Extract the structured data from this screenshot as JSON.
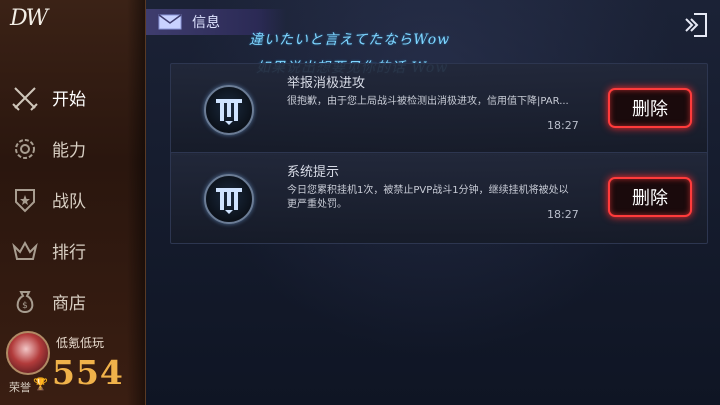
{
  "logo": "DW",
  "sidebar": {
    "items": [
      {
        "label": "开始",
        "icon": "crossed-swords-icon",
        "active": true
      },
      {
        "label": "能力",
        "icon": "gear-icon"
      },
      {
        "label": "战队",
        "icon": "shield-star-icon"
      },
      {
        "label": "排行",
        "icon": "crown-icon"
      },
      {
        "label": "商店",
        "icon": "money-bag-icon"
      }
    ]
  },
  "profile": {
    "name": "低氪低玩",
    "honor_label": "荣誉",
    "honor_icon": "trophy-icon",
    "honor_value": "554"
  },
  "header": {
    "title": "信息",
    "icon": "mail-icon"
  },
  "overlay": {
    "line1": "違いたいと言えてたならWow",
    "line2": "如果说出想要见你的话 Wow"
  },
  "messages": [
    {
      "title": "举报消极进攻",
      "body": "很抱歉，由于您上局战斗被检测出消极进攻，信用值下降|PAR...",
      "time": "18:27",
      "delete_label": "删除"
    },
    {
      "title": "系统提示",
      "body": "今日您累积挂机1次，被禁止PVP战斗1分钟，继续挂机将被处以更严重处罚。",
      "time": "18:27",
      "delete_label": "删除"
    }
  ],
  "colors": {
    "accent_red": "#ff3b3b",
    "honor_gold": "#f0b24a",
    "overlay_cyan": "#7fd6ff"
  }
}
